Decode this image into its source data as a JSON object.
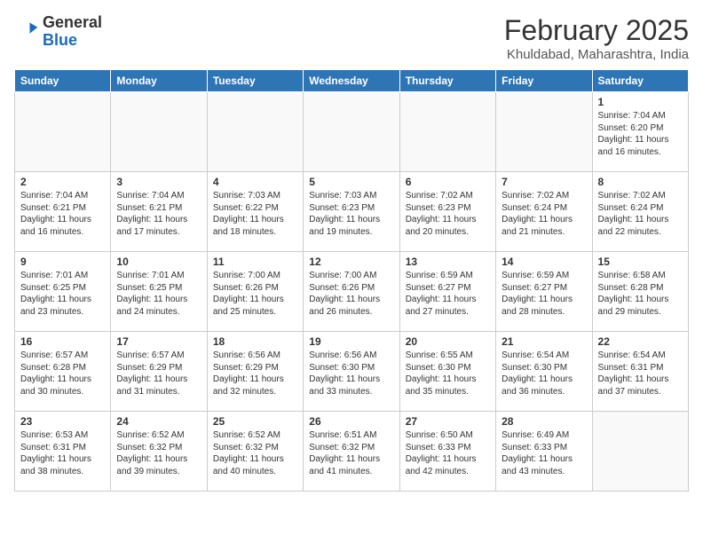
{
  "header": {
    "logo_general": "General",
    "logo_blue": "Blue",
    "month_year": "February 2025",
    "location": "Khuldabad, Maharashtra, India"
  },
  "weekdays": [
    "Sunday",
    "Monday",
    "Tuesday",
    "Wednesday",
    "Thursday",
    "Friday",
    "Saturday"
  ],
  "weeks": [
    [
      {
        "day": "",
        "info": ""
      },
      {
        "day": "",
        "info": ""
      },
      {
        "day": "",
        "info": ""
      },
      {
        "day": "",
        "info": ""
      },
      {
        "day": "",
        "info": ""
      },
      {
        "day": "",
        "info": ""
      },
      {
        "day": "1",
        "info": "Sunrise: 7:04 AM\nSunset: 6:20 PM\nDaylight: 11 hours\nand 16 minutes."
      }
    ],
    [
      {
        "day": "2",
        "info": "Sunrise: 7:04 AM\nSunset: 6:21 PM\nDaylight: 11 hours\nand 16 minutes."
      },
      {
        "day": "3",
        "info": "Sunrise: 7:04 AM\nSunset: 6:21 PM\nDaylight: 11 hours\nand 17 minutes."
      },
      {
        "day": "4",
        "info": "Sunrise: 7:03 AM\nSunset: 6:22 PM\nDaylight: 11 hours\nand 18 minutes."
      },
      {
        "day": "5",
        "info": "Sunrise: 7:03 AM\nSunset: 6:23 PM\nDaylight: 11 hours\nand 19 minutes."
      },
      {
        "day": "6",
        "info": "Sunrise: 7:02 AM\nSunset: 6:23 PM\nDaylight: 11 hours\nand 20 minutes."
      },
      {
        "day": "7",
        "info": "Sunrise: 7:02 AM\nSunset: 6:24 PM\nDaylight: 11 hours\nand 21 minutes."
      },
      {
        "day": "8",
        "info": "Sunrise: 7:02 AM\nSunset: 6:24 PM\nDaylight: 11 hours\nand 22 minutes."
      }
    ],
    [
      {
        "day": "9",
        "info": "Sunrise: 7:01 AM\nSunset: 6:25 PM\nDaylight: 11 hours\nand 23 minutes."
      },
      {
        "day": "10",
        "info": "Sunrise: 7:01 AM\nSunset: 6:25 PM\nDaylight: 11 hours\nand 24 minutes."
      },
      {
        "day": "11",
        "info": "Sunrise: 7:00 AM\nSunset: 6:26 PM\nDaylight: 11 hours\nand 25 minutes."
      },
      {
        "day": "12",
        "info": "Sunrise: 7:00 AM\nSunset: 6:26 PM\nDaylight: 11 hours\nand 26 minutes."
      },
      {
        "day": "13",
        "info": "Sunrise: 6:59 AM\nSunset: 6:27 PM\nDaylight: 11 hours\nand 27 minutes."
      },
      {
        "day": "14",
        "info": "Sunrise: 6:59 AM\nSunset: 6:27 PM\nDaylight: 11 hours\nand 28 minutes."
      },
      {
        "day": "15",
        "info": "Sunrise: 6:58 AM\nSunset: 6:28 PM\nDaylight: 11 hours\nand 29 minutes."
      }
    ],
    [
      {
        "day": "16",
        "info": "Sunrise: 6:57 AM\nSunset: 6:28 PM\nDaylight: 11 hours\nand 30 minutes."
      },
      {
        "day": "17",
        "info": "Sunrise: 6:57 AM\nSunset: 6:29 PM\nDaylight: 11 hours\nand 31 minutes."
      },
      {
        "day": "18",
        "info": "Sunrise: 6:56 AM\nSunset: 6:29 PM\nDaylight: 11 hours\nand 32 minutes."
      },
      {
        "day": "19",
        "info": "Sunrise: 6:56 AM\nSunset: 6:30 PM\nDaylight: 11 hours\nand 33 minutes."
      },
      {
        "day": "20",
        "info": "Sunrise: 6:55 AM\nSunset: 6:30 PM\nDaylight: 11 hours\nand 35 minutes."
      },
      {
        "day": "21",
        "info": "Sunrise: 6:54 AM\nSunset: 6:30 PM\nDaylight: 11 hours\nand 36 minutes."
      },
      {
        "day": "22",
        "info": "Sunrise: 6:54 AM\nSunset: 6:31 PM\nDaylight: 11 hours\nand 37 minutes."
      }
    ],
    [
      {
        "day": "23",
        "info": "Sunrise: 6:53 AM\nSunset: 6:31 PM\nDaylight: 11 hours\nand 38 minutes."
      },
      {
        "day": "24",
        "info": "Sunrise: 6:52 AM\nSunset: 6:32 PM\nDaylight: 11 hours\nand 39 minutes."
      },
      {
        "day": "25",
        "info": "Sunrise: 6:52 AM\nSunset: 6:32 PM\nDaylight: 11 hours\nand 40 minutes."
      },
      {
        "day": "26",
        "info": "Sunrise: 6:51 AM\nSunset: 6:32 PM\nDaylight: 11 hours\nand 41 minutes."
      },
      {
        "day": "27",
        "info": "Sunrise: 6:50 AM\nSunset: 6:33 PM\nDaylight: 11 hours\nand 42 minutes."
      },
      {
        "day": "28",
        "info": "Sunrise: 6:49 AM\nSunset: 6:33 PM\nDaylight: 11 hours\nand 43 minutes."
      },
      {
        "day": "",
        "info": ""
      }
    ]
  ]
}
